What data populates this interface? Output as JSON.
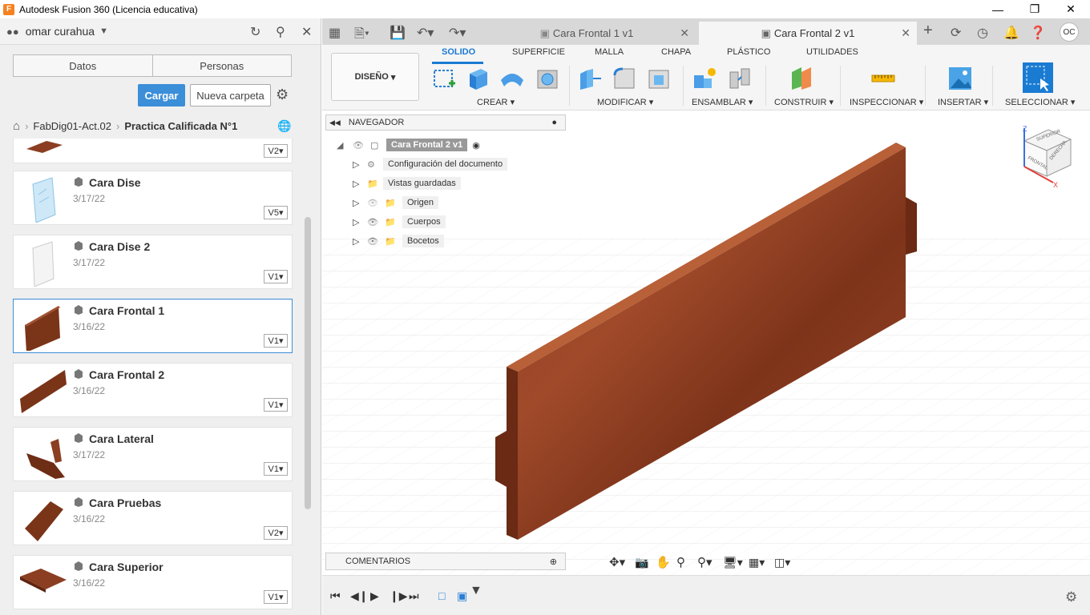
{
  "window": {
    "title": "Autodesk Fusion 360 (Licencia educativa)",
    "app_icon": "F"
  },
  "user": {
    "name": "omar curahua"
  },
  "panel_tabs": [
    "Datos",
    "Personas"
  ],
  "actions": {
    "upload": "Cargar",
    "new_folder": "Nueva carpeta"
  },
  "breadcrumb": {
    "project": "FabDig01-Act.02",
    "current": "Practica Calificada N°1"
  },
  "files": [
    {
      "name": "",
      "date": "",
      "version": "V2"
    },
    {
      "name": "Cara Dise",
      "date": "3/17/22",
      "version": "V5"
    },
    {
      "name": "Cara Dise 2",
      "date": "3/17/22",
      "version": "V1"
    },
    {
      "name": "Cara Frontal 1",
      "date": "3/16/22",
      "version": "V1"
    },
    {
      "name": "Cara Frontal 2",
      "date": "3/16/22",
      "version": "V1"
    },
    {
      "name": "Cara Lateral",
      "date": "3/17/22",
      "version": "V1"
    },
    {
      "name": "Cara Pruebas",
      "date": "3/16/22",
      "version": "V2"
    },
    {
      "name": "Cara Superior",
      "date": "3/16/22",
      "version": "V1"
    }
  ],
  "doc_tabs": [
    {
      "label": "Cara Frontal 1 v1"
    },
    {
      "label": "Cara Frontal 2 v1"
    }
  ],
  "user_initials": "OC",
  "workspace": "DISEÑO",
  "toolbar_tabs": [
    "SOLIDO",
    "SUPERFICIE",
    "MALLA",
    "CHAPA",
    "PLÁSTICO",
    "UTILIDADES"
  ],
  "toolbar_groups": [
    "CREAR",
    "MODIFICAR",
    "ENSAMBLAR",
    "CONSTRUIR",
    "INSPECCIONAR",
    "INSERTAR",
    "SELECCIONAR"
  ],
  "navigator": {
    "title": "NAVEGADOR",
    "root": "Cara Frontal 2 v1",
    "items": [
      "Configuración del documento",
      "Vistas guardadas",
      "Origen",
      "Cuerpos",
      "Bocetos"
    ]
  },
  "comments": "COMENTARIOS",
  "viewcube": {
    "top": "SUPERIOR",
    "front": "FRONTAL",
    "right": "DERECHA",
    "axis_z": "Z",
    "axis_x": "X"
  },
  "colors": {
    "accent": "#1a7bd3",
    "upload_btn": "#3b8ed8",
    "wood": "#8b3e22"
  }
}
